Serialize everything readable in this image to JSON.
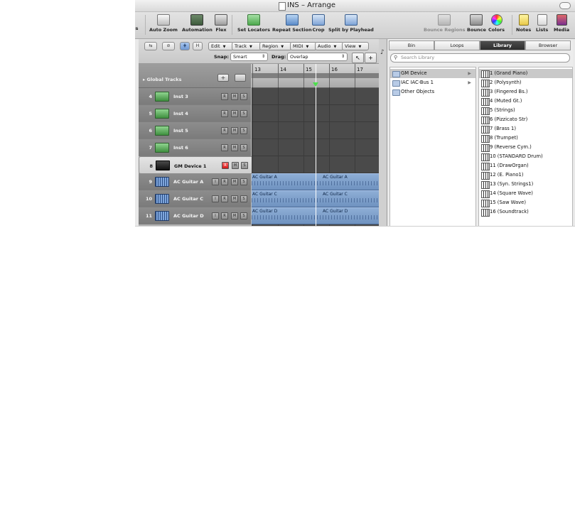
{
  "window": {
    "title": "INS – Arrange"
  },
  "toolbar": {
    "partial_left_label": "gs",
    "auto_zoom": "Auto Zoom",
    "automation": "Automation",
    "flex": "Flex",
    "set_locators": "Set Locators",
    "repeat_section": "Repeat Section",
    "crop": "Crop",
    "split_by_playhead": "Split by Playhead",
    "bounce_regions": "Bounce Regions",
    "bounce": "Bounce",
    "colors": "Colors",
    "notes": "Notes",
    "lists": "Lists",
    "media": "Media"
  },
  "arrange": {
    "menus": [
      "Edit",
      "Track",
      "Region",
      "MIDI",
      "Audio",
      "View"
    ],
    "snap_label": "Snap:",
    "snap_value": "Smart",
    "drag_label": "Drag:",
    "drag_value": "Overlap",
    "mini_buttons": [
      "⇆",
      "⊘",
      "⋕",
      "H"
    ],
    "global_tracks": "Global Tracks",
    "ruler_marks": [
      "13",
      "14",
      "15",
      "16",
      "17"
    ],
    "tracks": [
      {
        "num": "4",
        "name": "Inst 3",
        "type": "inst"
      },
      {
        "num": "5",
        "name": "Inst 4",
        "type": "inst"
      },
      {
        "num": "6",
        "name": "Inst 5",
        "type": "inst"
      },
      {
        "num": "7",
        "name": "Inst 6",
        "type": "inst"
      },
      {
        "num": "8",
        "name": "GM Device  1",
        "type": "gm"
      },
      {
        "num": "9",
        "name": "AC Guitar A",
        "type": "audio"
      },
      {
        "num": "10",
        "name": "AC Guitar C",
        "type": "audio"
      },
      {
        "num": "11",
        "name": "AC Guitar D",
        "type": "audio"
      }
    ],
    "regions": [
      {
        "labels": [
          "AC Guitar A",
          "AC Guitar A"
        ]
      },
      {
        "labels": [
          "AC Guitar C",
          "AC Guitar C"
        ]
      },
      {
        "labels": [
          "AC Guitar D",
          "AC Guitar D"
        ]
      }
    ],
    "track_buttons": {
      "record": "R",
      "mute": "M",
      "solo": "S",
      "input": "I"
    }
  },
  "media": {
    "tabs": [
      "Bin",
      "Loops",
      "Library",
      "Browser"
    ],
    "active_tab": "Library",
    "search_placeholder": "Search Library",
    "devices": [
      "GM Device",
      "IAC IAC-Bus 1",
      "Other Objects"
    ],
    "patches": [
      "1 (Grand Piano)",
      "2 (Polysynth)",
      "3 (Fingered Bs.)",
      "4 (Muted Gt.)",
      "5 (Strings)",
      "6 (Pizzicato Str)",
      "7 (Brass 1)",
      "8 (Trumpet)",
      "9 (Reverse Cym.)",
      "10 (STANDARD Drum)",
      "11 (DrawOrgan)",
      "12 (E. Piano1)",
      "13 (Syn. Strings1)",
      "14 (Square Wave)",
      "15 (Saw Wave)",
      "16 (Soundtrack)"
    ]
  },
  "colors": {
    "region_blue": "#7f9fcc",
    "lane_bg": "#4a4a4a",
    "playhead_green": "#4de04d"
  }
}
